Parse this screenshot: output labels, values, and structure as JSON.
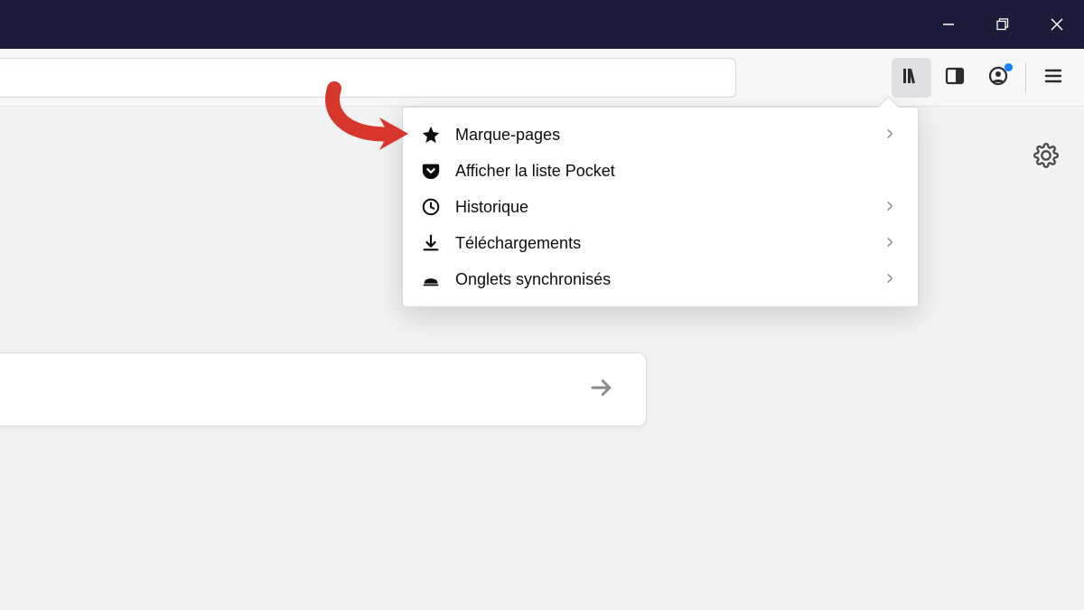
{
  "window_controls": {
    "minimize": "minimize",
    "restore": "restore",
    "close": "close"
  },
  "toolbar": {
    "library_button": "Library",
    "sidebar_button": "Sidebar",
    "account_button": "Account",
    "menu_button": "Menu"
  },
  "library_menu": {
    "items": [
      {
        "icon": "star-icon",
        "label": "Marque-pages",
        "has_submenu": true
      },
      {
        "icon": "pocket-icon",
        "label": "Afficher la liste Pocket",
        "has_submenu": false
      },
      {
        "icon": "clock-icon",
        "label": "Historique",
        "has_submenu": true
      },
      {
        "icon": "download-icon",
        "label": "Téléchargements",
        "has_submenu": true
      },
      {
        "icon": "tabs-icon",
        "label": "Onglets synchronisés",
        "has_submenu": true
      }
    ]
  },
  "page": {
    "settings_button": "Settings"
  },
  "annotation": {
    "type": "arrow",
    "color": "#d6362c",
    "target": "library_menu.items.0"
  }
}
